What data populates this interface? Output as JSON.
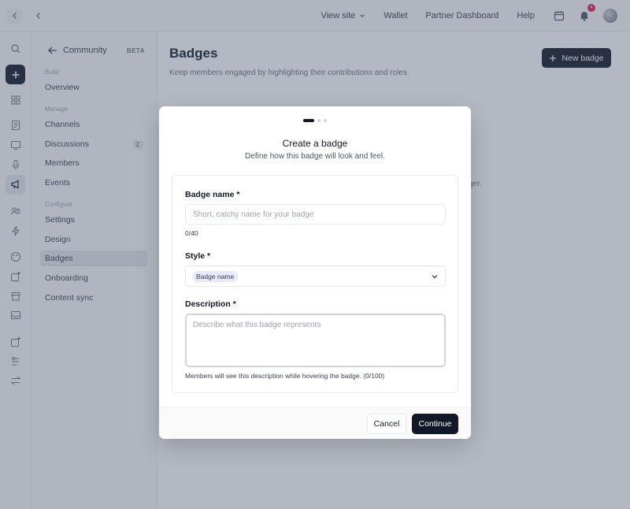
{
  "topbar": {
    "nav": [
      {
        "label": "View site"
      },
      {
        "label": "Wallet"
      },
      {
        "label": "Partner Dashboard"
      },
      {
        "label": "Help"
      }
    ],
    "notification_count": "4"
  },
  "sidebar": {
    "back_label": "Community",
    "beta_label": "BETA",
    "sections": {
      "build": "Build",
      "manage": "Manage",
      "configure": "Configure"
    },
    "items": [
      {
        "label": "Overview"
      },
      {
        "label": "Channels"
      },
      {
        "label": "Discussions",
        "count": "2"
      },
      {
        "label": "Members"
      },
      {
        "label": "Events"
      },
      {
        "label": "Settings"
      },
      {
        "label": "Design"
      },
      {
        "label": "Badges"
      },
      {
        "label": "Onboarding"
      },
      {
        "label": "Content sync"
      }
    ]
  },
  "main": {
    "title": "Badges",
    "subtitle": "Keep members engaged by highlighting their contributions and roles.",
    "new_badge_label": "New badge",
    "background_fragment": "ger."
  },
  "modal": {
    "steps_total": 3,
    "current_step": 1,
    "title": "Create a badge",
    "subtitle": "Define how this badge will look and feel.",
    "badge_name": {
      "label": "Badge name *",
      "value": "",
      "placeholder": "Short, catchy name for your badge",
      "counter": "0/40"
    },
    "style": {
      "label": "Style *",
      "selected_pill": "Badge name"
    },
    "description": {
      "label": "Description *",
      "value": "",
      "placeholder": "Describe what this badge represents",
      "helper": "Members will see this description while hovering the badge. (0/100)"
    },
    "cancel_label": "Cancel",
    "continue_label": "Continue"
  },
  "colors": {
    "primary": "#111827",
    "overlay": "#4b556e",
    "pill_bg": "#e9e9fb",
    "notification": "#e11d48"
  }
}
